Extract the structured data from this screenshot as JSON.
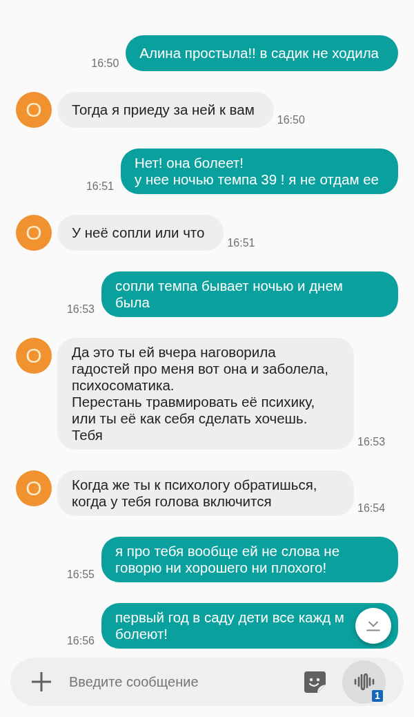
{
  "messages": [
    {
      "kind": "outgoing",
      "text": "Алина простыла!! в садик не ходила",
      "time": "16:50"
    },
    {
      "kind": "incoming",
      "avatar": "О",
      "text": "Тогда я приеду за ней к вам",
      "time": "16:50"
    },
    {
      "kind": "outgoing",
      "text": "Нет! она болеет!\nу нее ночью темпа 39 ! я не отдам ее",
      "time": "16:51"
    },
    {
      "kind": "incoming",
      "avatar": "О",
      "text": "У неё сопли или что",
      "time": "16:51"
    },
    {
      "kind": "outgoing",
      "text": "сопли темпа бывает ночью и днем была",
      "time": "16:53"
    },
    {
      "kind": "incoming",
      "avatar": "О",
      "text": "Да это ты ей вчера наговорила гадостей про меня вот она и заболела, психосоматика.\nПерестань травмировать её психику, или ты её как себя сделать хочешь. Тебя",
      "time": "16:53"
    },
    {
      "kind": "incoming",
      "avatar": "О",
      "text": "Когда же ты к психологу обратишься, когда у тебя голова включится",
      "time": "16:54"
    },
    {
      "kind": "outgoing",
      "text": "я про тебя вообще ей не слова не говорю ни хорошего ни плохого!",
      "time": "16:55"
    },
    {
      "kind": "outgoing",
      "text": "первый год в саду дети все кажд м болеют!",
      "time": "16:56"
    }
  ],
  "composer": {
    "placeholder": "Введите сообщение",
    "voice_badge": "1"
  }
}
